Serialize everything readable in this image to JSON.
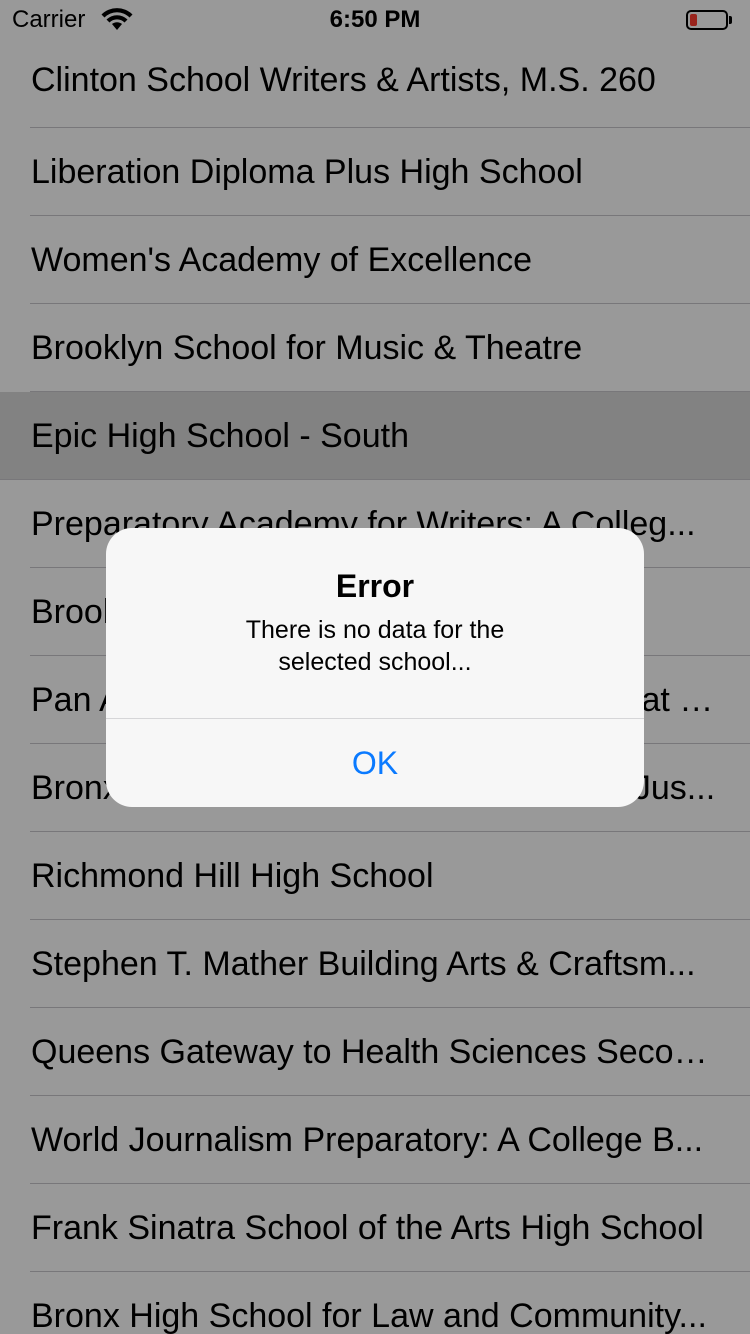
{
  "status_bar": {
    "carrier": "Carrier",
    "time": "6:50 PM",
    "wifi_icon": "wifi-icon",
    "battery_icon": "battery-low-icon",
    "battery_level_color": "#ff3b30"
  },
  "schools": [
    "Clinton School Writers & Artists, M.S. 260",
    "Liberation Diploma Plus High School",
    "Women's Academy of Excellence",
    "Brooklyn School for Music & Theatre",
    "Epic High School - South",
    "Preparatory Academy for Writers: A Colleg...",
    "Brooklyn School for Global Studies",
    "Pan American International High School at Monroe",
    "Bronx School for Law, Government and Jus...",
    "Richmond Hill High School",
    "Stephen T. Mather Building Arts & Craftsm...",
    "Queens Gateway to Health Sciences Secon...",
    "World Journalism Preparatory: A College B...",
    "Frank Sinatra School of the Arts High School",
    "Bronx High School for Law and Community..."
  ],
  "selected_index": 4,
  "alert": {
    "title": "Error",
    "message_line1": "There is no data for the",
    "message_line2": "selected school...",
    "button_label": "OK",
    "button_color": "#0a7aff"
  }
}
